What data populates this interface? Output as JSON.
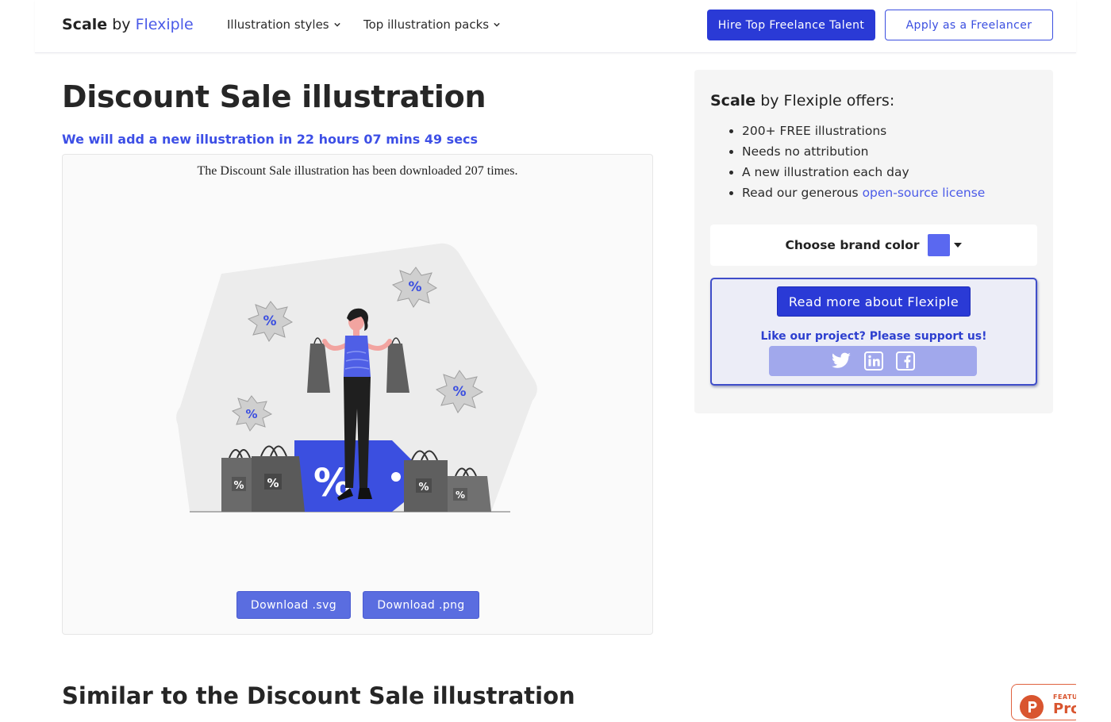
{
  "header": {
    "logo": {
      "bold": "Scale",
      "by": " by ",
      "brand": "Flexiple"
    },
    "nav": [
      {
        "label": "Illustration styles"
      },
      {
        "label": "Top illustration packs"
      }
    ],
    "hire_label": "Hire Top Freelance Talent",
    "apply_label": "Apply as a Freelancer"
  },
  "main": {
    "title": "Discount Sale illustration",
    "countdown": "We will add a new illustration in 22 hours 07 mins 49 secs",
    "download_count": "The Discount Sale illustration has been downloaded 207 times.",
    "download_svg": "Download .svg",
    "download_png": "Download .png",
    "similar_title": "Similar to the Discount Sale illustration"
  },
  "sidebar": {
    "offers_bold": "Scale",
    "offers_rest": " by Flexiple offers:",
    "offers": [
      "200+ FREE illustrations",
      "Needs no attribution",
      "A new illustration each day"
    ],
    "license_prefix": "Read our generous ",
    "license_link": "open-source license",
    "brand_color_label": "Choose brand color",
    "brand_color": "#5a68f0",
    "read_more": "Read more about Flexiple",
    "support_text": "Like our project? Please support us!",
    "social_icons": [
      "twitter-icon",
      "linkedin-icon",
      "facebook-icon"
    ]
  },
  "badge": {
    "top": "FEATU",
    "main": "Pro"
  },
  "colors": {
    "accent": "#2a3ad6",
    "brand": "#4a5ae8",
    "download_button": "#5a6de0"
  }
}
